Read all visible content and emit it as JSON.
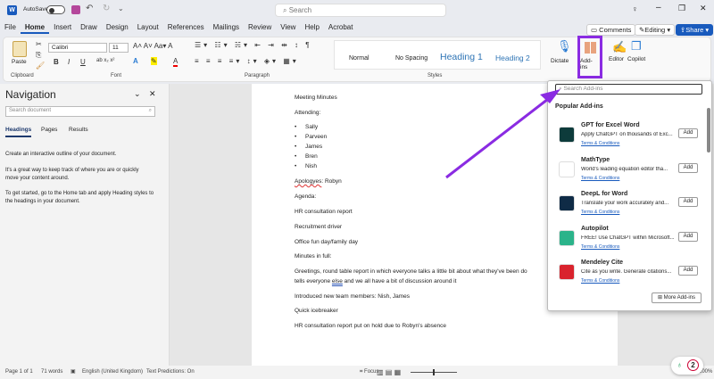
{
  "titlebar": {
    "autosave": "AutoSave",
    "search_placeholder": "Search"
  },
  "tabs": [
    "File",
    "Home",
    "Insert",
    "Draw",
    "Design",
    "Layout",
    "References",
    "Mailings",
    "Review",
    "View",
    "Help",
    "Acrobat"
  ],
  "actions": {
    "comments": "Comments",
    "editing": "Editing",
    "share": "Share"
  },
  "ribbon": {
    "paste": "Paste",
    "font": "Calibri",
    "size": "11",
    "groups": {
      "clipboard": "Clipboard",
      "font": "Font",
      "paragraph": "Paragraph",
      "styles": "Styles"
    },
    "styles": [
      "Normal",
      "No Spacing",
      "Heading 1",
      "Heading 2"
    ],
    "dictate": "Dictate",
    "addins": "Add-ins",
    "editor": "Editor",
    "copilot": "Copilot"
  },
  "nav": {
    "title": "Navigation",
    "search_placeholder": "Search document",
    "tabs": [
      "Headings",
      "Pages",
      "Results"
    ],
    "text": [
      "Create an interactive outline of your document.",
      "It's a great way to keep track of where you are or quickly move your content around.",
      "To get started, go to the Home tab and apply Heading styles to the headings in your document."
    ]
  },
  "doc": {
    "title": "Meeting Minutes",
    "attending": "Attending:",
    "attendees": [
      "Sally",
      "Parveen",
      "James",
      "Bren",
      "Nish"
    ],
    "apologies_word": "Apologyes",
    "apologies_rest": ": Robyn",
    "lines": [
      "Agenda:",
      "HR consultation report",
      "Recruitment driver",
      "Office fun day/family day",
      "Minutes in full:"
    ],
    "para1": "Greetings, round table report in which everyone talks a little bit about what they've been do",
    "para2_a": "tells everyone ",
    "para2_b": "else",
    "para2_c": " and we all have a bit of discussion around it",
    "lines2": [
      "Introduced new team members: Nish, James",
      "Quick icebreaker",
      "HR consultation report put on hold due to Robyn's absence"
    ]
  },
  "addins": {
    "search_placeholder": "Search Add-ins",
    "heading": "Popular Add-ins",
    "more": "More Add-ins",
    "items": [
      {
        "name": "GPT for Excel Word",
        "desc": "Apply ChatGPT on thousands of Exc...",
        "terms": "Terms & Conditions",
        "add": "Add",
        "color": "#0d3b3b"
      },
      {
        "name": "MathType",
        "desc": "World's leading equation editor tha...",
        "terms": "Terms & Conditions",
        "add": "Add",
        "color": "#ffffff"
      },
      {
        "name": "DeepL for Word",
        "desc": "Translate your work accurately and...",
        "terms": "Terms & Conditions",
        "add": "Add",
        "color": "#0f2b46"
      },
      {
        "name": "Autopilot",
        "desc": "FREE! Use ChatGPT within Microsoft...",
        "terms": "Terms & Conditions",
        "add": "Add",
        "color": "#2bb38a"
      },
      {
        "name": "Mendeley Cite",
        "desc": "Cite as you write. Generate citations...",
        "terms": "Terms & Conditions",
        "add": "Add",
        "color": "#d9232d"
      }
    ]
  },
  "status": {
    "page": "Page 1 of 1",
    "words": "71 words",
    "language": "English (United Kingdom)",
    "predictions": "Text Predictions: On",
    "focus": "Focus",
    "zoom": "100%",
    "badge": "2"
  },
  "colors": {
    "accent": "#185abd",
    "highlight": "#8a2be2"
  }
}
